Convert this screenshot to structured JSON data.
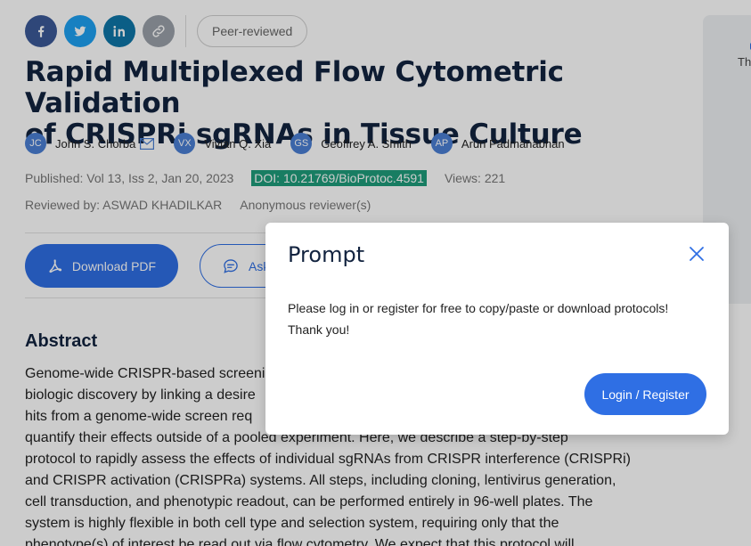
{
  "share": {
    "icons": [
      "facebook-icon",
      "twitter-icon",
      "linkedin-icon",
      "link-icon"
    ],
    "badge": "Peer-reviewed"
  },
  "article": {
    "title_line1": "Rapid Multiplexed Flow Cytometric Validation",
    "title_line2": "of CRISPRi sgRNAs in Tissue Culture",
    "authors": [
      {
        "initials": "JC",
        "name": "John S. Chorba",
        "has_mail": true
      },
      {
        "initials": "VX",
        "name": "Vivian Q. Xia"
      },
      {
        "initials": "GS",
        "name": "Geoffrey A. Smith"
      },
      {
        "initials": "AP",
        "name": "Arun Padmanabhan"
      }
    ],
    "published": "Published: Vol 13, Iss 2, Jan 20, 2023",
    "doi": "DOI: 10.21769/BioProtoc.4591",
    "views": "Views: 221",
    "reviewed_by": "Reviewed by: ASWAD KHADILKAR",
    "anonymous": "Anonymous reviewer(s)"
  },
  "actions": {
    "download": "Download PDF",
    "ask": "Ask"
  },
  "abstract": {
    "heading": "Abstract",
    "lines": [
      "Genome-wide CRISPR-based screeni",
      "biologic discovery by linking a desire",
      "hits from a genome-wide screen req",
      "quantify their effects outside of a pooled experiment. Here, we describe a step-by-step",
      "protocol to rapidly assess the effects of individual sgRNAs from CRISPR interference (CRISPRi)",
      "and CRISPR activation (CRISPRa) systems. All steps, including cloning, lentivirus generation,",
      "cell transduction, and phenotypic readout, can be performed entirely in 96-well plates. The",
      "system is highly flexible in both cell type and selection system, requiring only that the",
      "phenotype(s) of interest be read out via flow cytometry. We expect that this protocol will"
    ]
  },
  "side": {
    "text": "Th"
  },
  "modal": {
    "title": "Prompt",
    "message_line1": "Please log in or register for free to copy/paste or download protocols!",
    "message_line2": "Thank you!",
    "button": "Login / Register"
  },
  "colors": {
    "accent": "#2f6fe4",
    "doi_highlight": "#1f9d7b",
    "title": "#12233f",
    "facebook": "#3b5998",
    "twitter": "#1da1f2",
    "linkedin": "#0e76a8",
    "link": "#9aa1a9"
  }
}
